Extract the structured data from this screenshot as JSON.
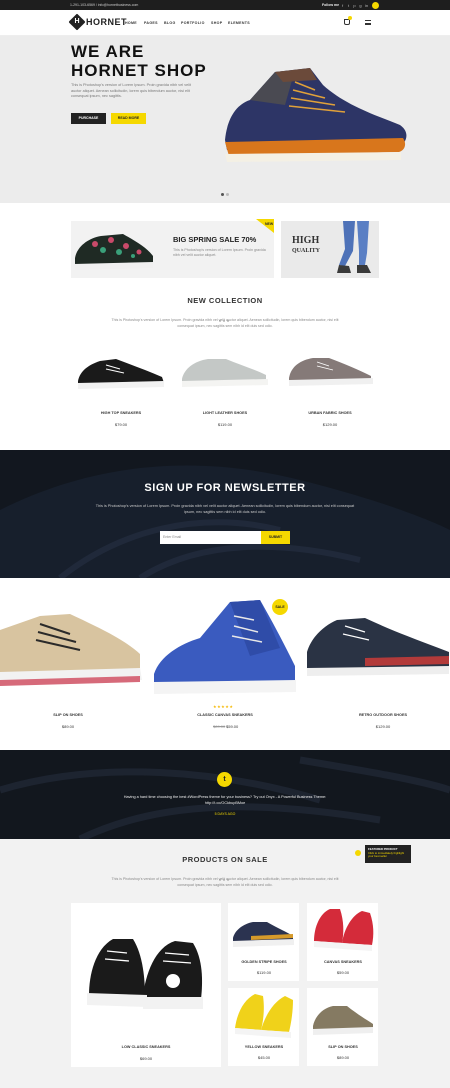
{
  "topbar": {
    "contact": "1-291-103-6569 / info@hornetbusiness.com",
    "follow_label": "Follow me",
    "social_icons": [
      "facebook-icon",
      "twitter-icon",
      "pinterest-icon",
      "google-plus-icon",
      "linkedin-icon"
    ]
  },
  "header": {
    "logo": "HORNET",
    "nav": [
      "HOME",
      "PAGES",
      "BLOG",
      "PORTFOLIO",
      "SHOP",
      "ELEMENTS"
    ]
  },
  "hero": {
    "title_line1": "WE ARE",
    "title_line2": "HORNET SHOP",
    "text": "This is Photoshop's version of Lorem Ipsum. Proin gravida nibh vel velit auctor aliquet. Aenean sollicitudin, lorem quis bibendum auctor, nisi elit consequat ipsum, nec sagittis.",
    "btn_primary": "PURCHASE",
    "btn_secondary": "READ MORE"
  },
  "promo": {
    "badge": "NEW",
    "title": "BIG SPRING SALE 70%",
    "text": "This is Photoshop's version of Lorem Ipsum. Proin gravida nibh vel velit auctor aliquet.",
    "hq_line1": "HIGH",
    "hq_line2": "QUALITY"
  },
  "new_collection": {
    "title": "NEW COLLECTION",
    "text": "This is Photoshop's version of Lorem Ipsum. Proin gravida nibh vel velit auctor aliquet. Aenean sollicitudin, lorem quis bibendum auctor, nisi elit consequat ipsum, nec sagittis sem nibh id elit duis sed odio.",
    "products": [
      {
        "name": "HIGH TOP SNEAKERS",
        "price": "$79.00"
      },
      {
        "name": "LIGHT LEATHER SHOES",
        "price": "$119.00"
      },
      {
        "name": "URBAN FABRIC SHOES",
        "price": "$129.00"
      }
    ]
  },
  "newsletter": {
    "title": "SIGN UP FOR NEWSLETTER",
    "text": "This is Photoshop's version of Lorem Ipsum. Proin gravida nibh vel velit auctor aliquet. Aenean sollicitudin, lorem quis bibendum auctor, nisi elit consequat ipsum, nec sagittis sem nibh id elit duis sed odio.",
    "placeholder": "Enter Email",
    "button": "SUBMIT"
  },
  "carousel": {
    "sale_badge": "SALE",
    "products": [
      {
        "name": "SLIP ON SHOES",
        "price": "$89.00"
      },
      {
        "name": "CLASSIC CANVAS SNEAKERS",
        "old_price": "$89.00",
        "price": "$59.00",
        "rating": 5
      },
      {
        "name": "RETRO OUTDOOR SHOES",
        "price": "$129.00"
      }
    ]
  },
  "twitter": {
    "text": "Having a hard time choosing the best #WordPress theme for your business? Try out Onyx - A Powerful Business Theme: http://t.co/OCkbupBMoe",
    "date": "5 DAYS AGO"
  },
  "on_sale": {
    "title": "PRODUCTS ON SALE",
    "text": "This is Photoshop's version of Lorem Ipsum. Proin gravida nibh vel velit auctor aliquet. Aenean sollicitudin, lorem quis bibendum auctor, nisi elit consequat ipsum, nec sagittis sem nibh id elit duis sed odio.",
    "featured_label": "FEATURED PRODUCT",
    "featured_text": "Click to immediately highlight your best seller",
    "products": [
      {
        "name": "LOW CLASSIC SNEAKERS",
        "price": "$69.00"
      },
      {
        "name": "GOLDEN STRIPE SHOES",
        "price": "$119.00"
      },
      {
        "name": "CANVAS SNEAKERS",
        "price": "$59.00"
      },
      {
        "name": "YELLOW SNEAKERS",
        "price": "$45.00"
      },
      {
        "name": "SLIP ON SHOES",
        "price": "$89.00"
      }
    ]
  },
  "colors": {
    "accent": "#f5d800",
    "dark": "#222222",
    "navy_shoe": "#2d3566",
    "blue_shoe": "#3a5bbf"
  }
}
